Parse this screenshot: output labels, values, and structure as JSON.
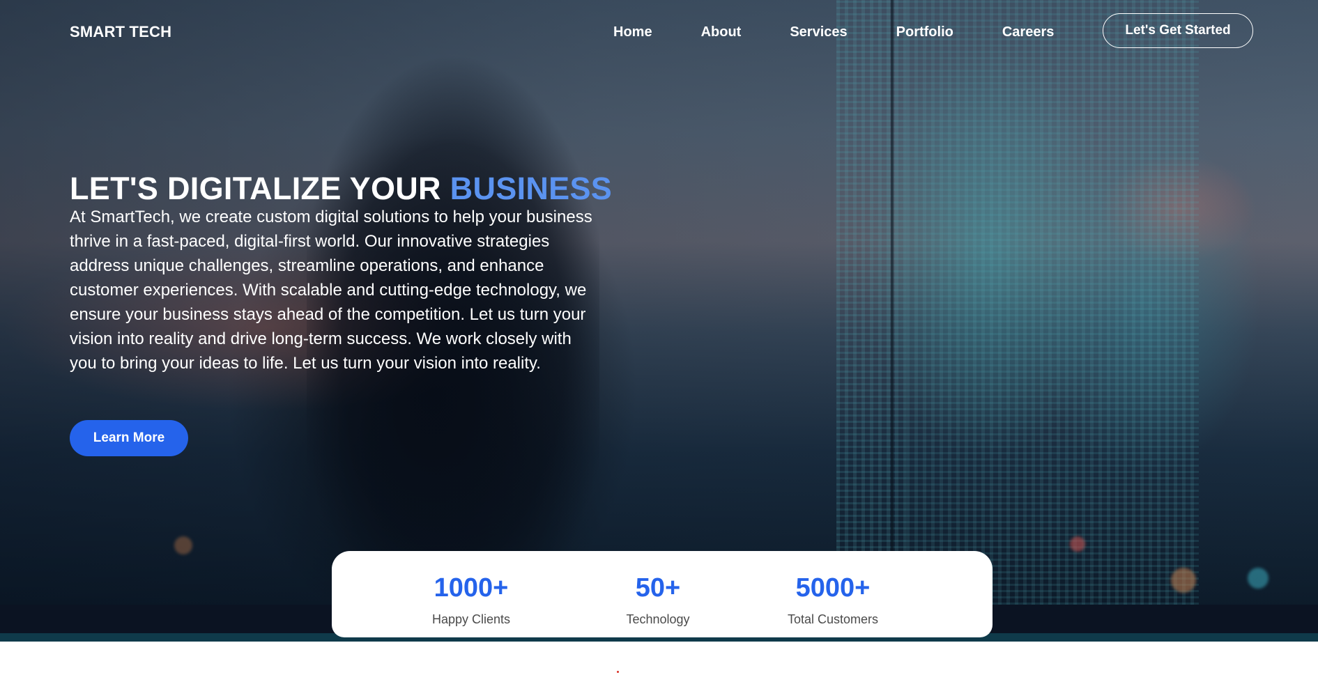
{
  "brand": {
    "name": "SMART TECH"
  },
  "nav": {
    "links": [
      {
        "label": "Home"
      },
      {
        "label": "About"
      },
      {
        "label": "Services"
      },
      {
        "label": "Portfolio"
      },
      {
        "label": "Careers"
      }
    ],
    "cta_label": "Let's Get Started"
  },
  "hero": {
    "headline_main": "LET'S DIGITALIZE YOUR",
    "headline_accent": "BUSINESS",
    "body": "At SmartTech, we create custom digital solutions to help your business thrive in a fast-paced, digital-first world. Our innovative strategies address unique challenges, streamline operations, and enhance customer experiences. With scalable and cutting-edge technology, we ensure your business stays ahead of the competition. Let us turn your vision into reality and drive long-term success. We work closely with you to bring your ideas to life. Let us turn your vision into reality.",
    "button_label": "Learn More"
  },
  "stats": [
    {
      "value": "1000+",
      "label": "Happy Clients"
    },
    {
      "value": "50+",
      "label": "Technology"
    },
    {
      "value": "5000+",
      "label": "Total Customers"
    }
  ],
  "colors": {
    "accent": "#2563eb",
    "headline_accent": "#5b93f0",
    "dark_band": "#0b1322"
  }
}
